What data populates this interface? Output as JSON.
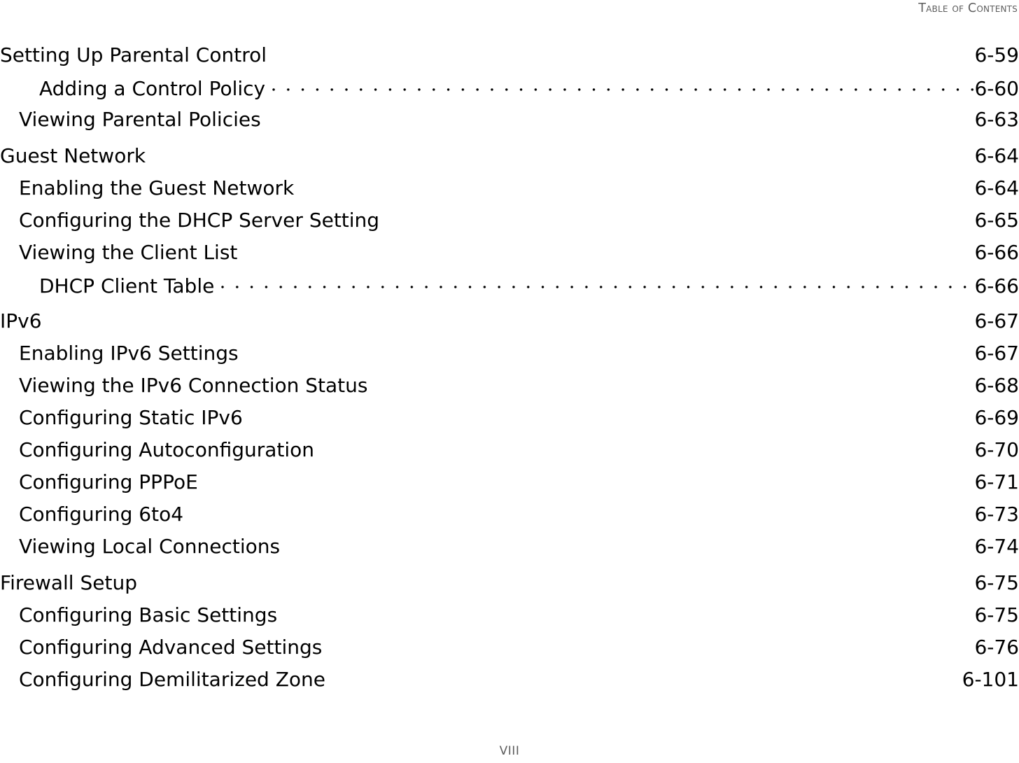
{
  "header": {
    "title": "Table of Contents"
  },
  "footer": {
    "page_label": "VIII"
  },
  "toc": {
    "entries": [
      {
        "title": "Setting Up Parental Control",
        "page": "6-59",
        "level": 1,
        "leader": false,
        "gap_before": false
      },
      {
        "title": "Adding a Control Policy",
        "page": "6-60",
        "level": 3,
        "leader": true,
        "gap_before": false
      },
      {
        "title": "Viewing Parental Policies",
        "page": "6-63",
        "level": 2,
        "leader": false,
        "gap_before": false
      },
      {
        "title": "Guest Network",
        "page": "6-64",
        "level": 1,
        "leader": false,
        "gap_before": true
      },
      {
        "title": "Enabling the Guest Network",
        "page": "6-64",
        "level": 2,
        "leader": false,
        "gap_before": false
      },
      {
        "title": "Configuring the DHCP Server Setting",
        "page": "6-65",
        "level": 2,
        "leader": false,
        "gap_before": false
      },
      {
        "title": "Viewing the Client List",
        "page": "6-66",
        "level": 2,
        "leader": false,
        "gap_before": false
      },
      {
        "title": "DHCP Client Table",
        "page": "6-66",
        "level": 3,
        "leader": true,
        "gap_before": false
      },
      {
        "title": "IPv6",
        "page": "6-67",
        "level": 1,
        "leader": false,
        "gap_before": true
      },
      {
        "title": "Enabling IPv6 Settings",
        "page": "6-67",
        "level": 2,
        "leader": false,
        "gap_before": false
      },
      {
        "title": "Viewing the IPv6 Connection Status",
        "page": "6-68",
        "level": 2,
        "leader": false,
        "gap_before": false
      },
      {
        "title": "Configuring Static IPv6",
        "page": "6-69",
        "level": 2,
        "leader": false,
        "gap_before": false
      },
      {
        "title": "Configuring Autoconfiguration",
        "page": "6-70",
        "level": 2,
        "leader": false,
        "gap_before": false
      },
      {
        "title": "Configuring PPPoE",
        "page": "6-71",
        "level": 2,
        "leader": false,
        "gap_before": false
      },
      {
        "title": "Configuring 6to4",
        "page": "6-73",
        "level": 2,
        "leader": false,
        "gap_before": false
      },
      {
        "title": "Viewing Local Connections",
        "page": "6-74",
        "level": 2,
        "leader": false,
        "gap_before": false
      },
      {
        "title": "Firewall Setup",
        "page": "6-75",
        "level": 1,
        "leader": false,
        "gap_before": true
      },
      {
        "title": "Configuring Basic Settings",
        "page": "6-75",
        "level": 2,
        "leader": false,
        "gap_before": false
      },
      {
        "title": "Configuring Advanced Settings",
        "page": "6-76",
        "level": 2,
        "leader": false,
        "gap_before": false
      },
      {
        "title": "Configuring Demilitarized Zone",
        "page": "6-101",
        "level": 2,
        "leader": false,
        "gap_before": false
      }
    ]
  }
}
